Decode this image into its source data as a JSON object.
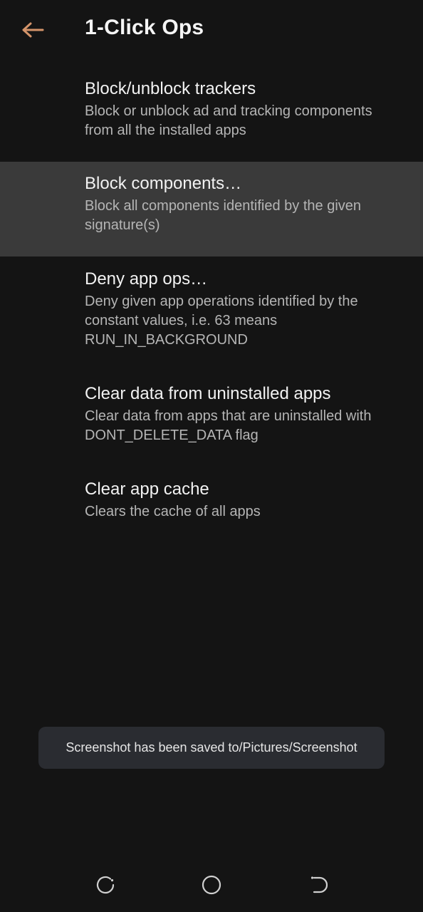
{
  "app_bar": {
    "title": "1-Click Ops",
    "back_icon": "arrow-left-icon",
    "accent_color": "#d4946a"
  },
  "ops": [
    {
      "title": "Block/unblock trackers",
      "summary": "Block or unblock ad and tracking components from all the installed apps",
      "selected": false
    },
    {
      "title": "Block components…",
      "summary": "Block all components identified by the given signature(s)",
      "selected": true
    },
    {
      "title": "Deny app ops…",
      "summary": "Deny given app operations identified by the constant values, i.e. 63 means RUN_IN_BACKGROUND",
      "selected": false
    },
    {
      "title": "Clear data from uninstalled apps",
      "summary": "Clear data from apps that are uninstalled with DONT_DELETE_DATA flag",
      "selected": false
    },
    {
      "title": "Clear app cache",
      "summary": "Clears the cache of all apps",
      "selected": false
    }
  ],
  "toast": {
    "message": "Screenshot has been saved to/Pictures/Screenshot"
  },
  "nav_bar": {
    "recents_icon": "recents-icon",
    "home_icon": "home-icon",
    "back_icon": "nav-back-icon"
  }
}
